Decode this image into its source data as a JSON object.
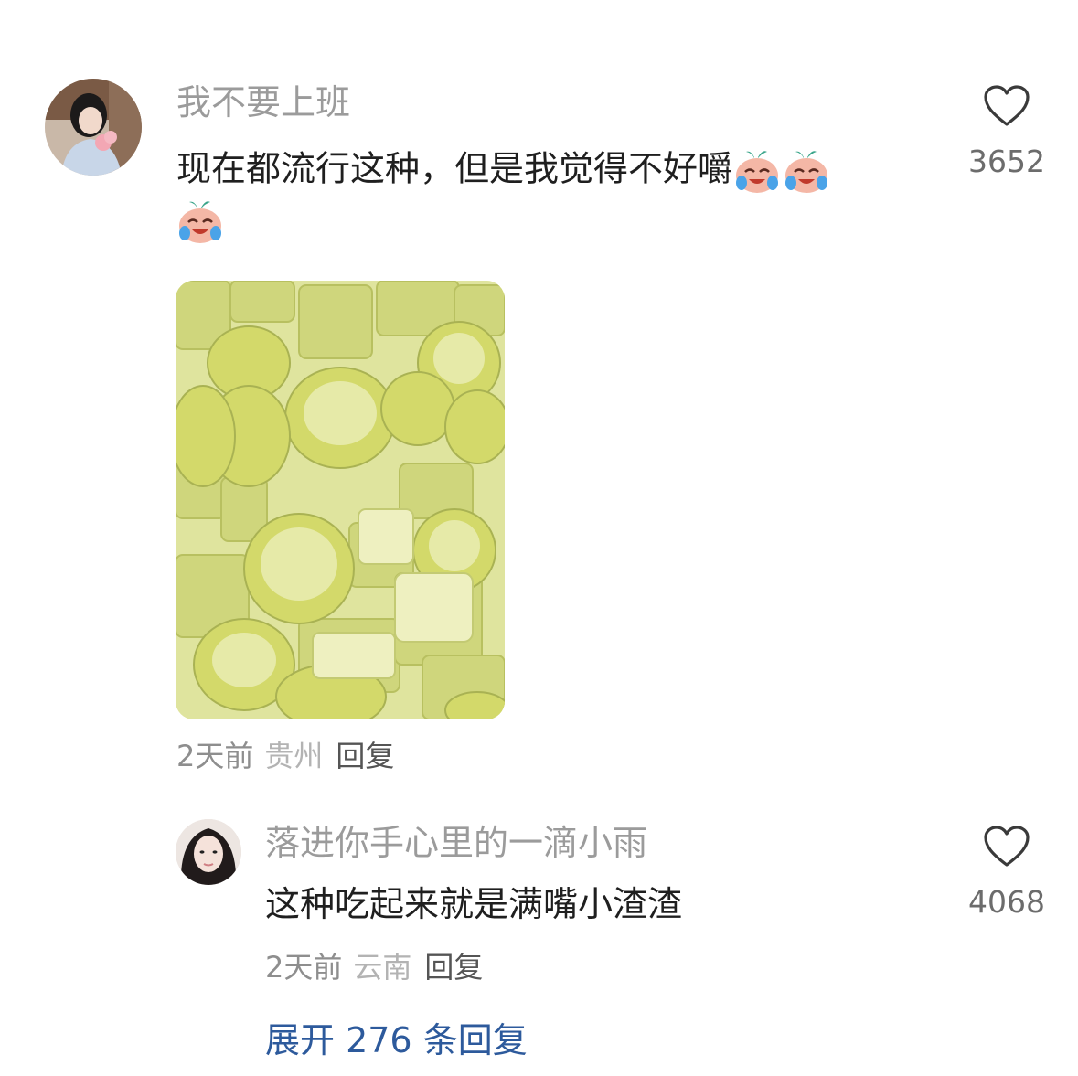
{
  "comments": [
    {
      "username": "我不要上班",
      "text_line1": "现在都流行这种，但是我觉得不好嚼",
      "emoji": "crying-laughing-radish-emoji",
      "time": "2天前",
      "location": "贵州",
      "reply_label": "回复",
      "like_count": "3652",
      "image": "sugarcane-pieces-photo"
    },
    {
      "username": "落进你手心里的一滴小雨",
      "text": "这种吃起来就是满嘴小渣渣",
      "time": "2天前",
      "location": "云南",
      "reply_label": "回复",
      "like_count": "4068"
    }
  ],
  "expand_replies": "展开 276 条回复",
  "colors": {
    "username": "#9b9b9b",
    "text": "#1f1f1f",
    "link": "#2d5a9c",
    "meta": "#8e8e8e"
  }
}
